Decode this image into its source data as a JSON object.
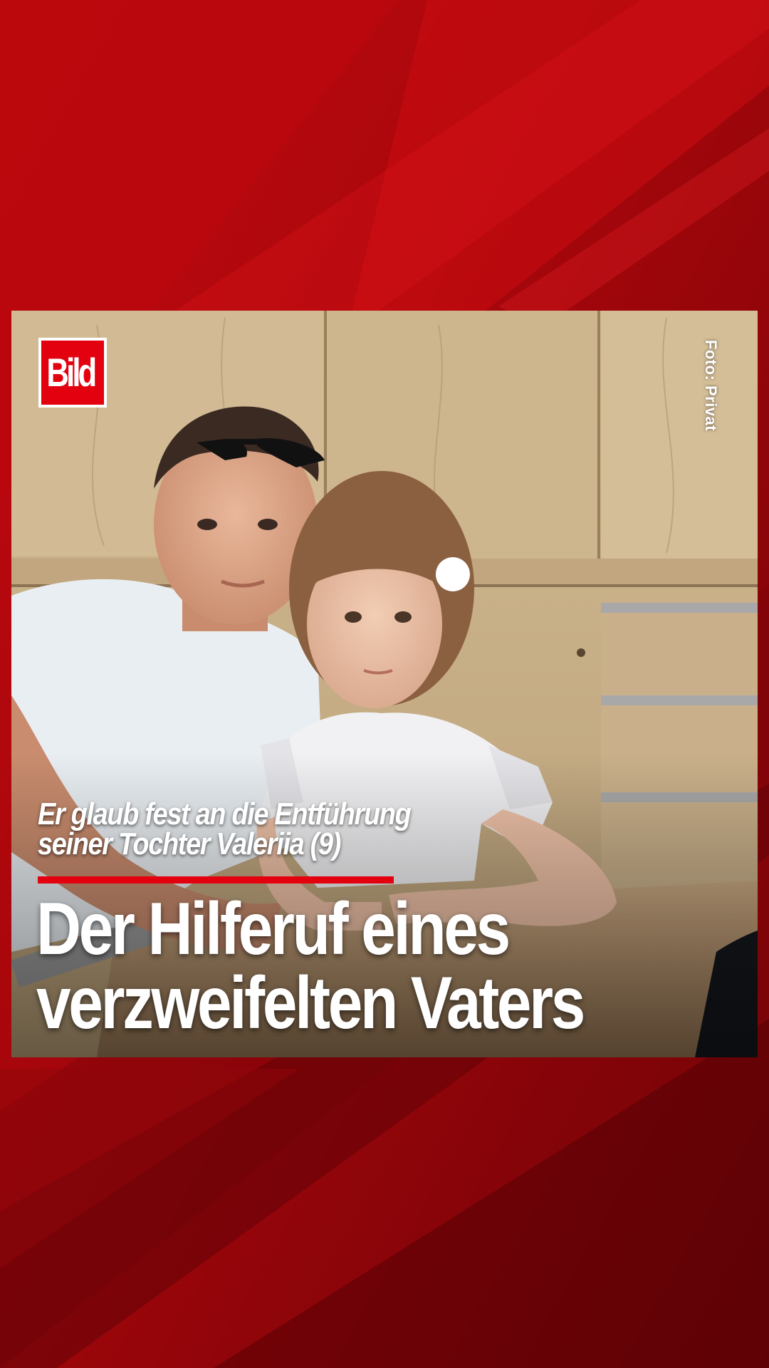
{
  "brand": {
    "logo_text": "Bild",
    "color": "#e3000f"
  },
  "photo": {
    "credit": "Foto: Privat"
  },
  "story": {
    "kicker_line_1": "Er glaub fest an die Entführung",
    "kicker_line_2": "seiner Tochter Valeriia (9)",
    "headline_line_1": "Der Hilferuf eines",
    "headline_line_2": "verzweifelten Vaters"
  },
  "colors": {
    "background": "#a8070b",
    "accent": "#e3000f",
    "text": "#ffffff"
  }
}
